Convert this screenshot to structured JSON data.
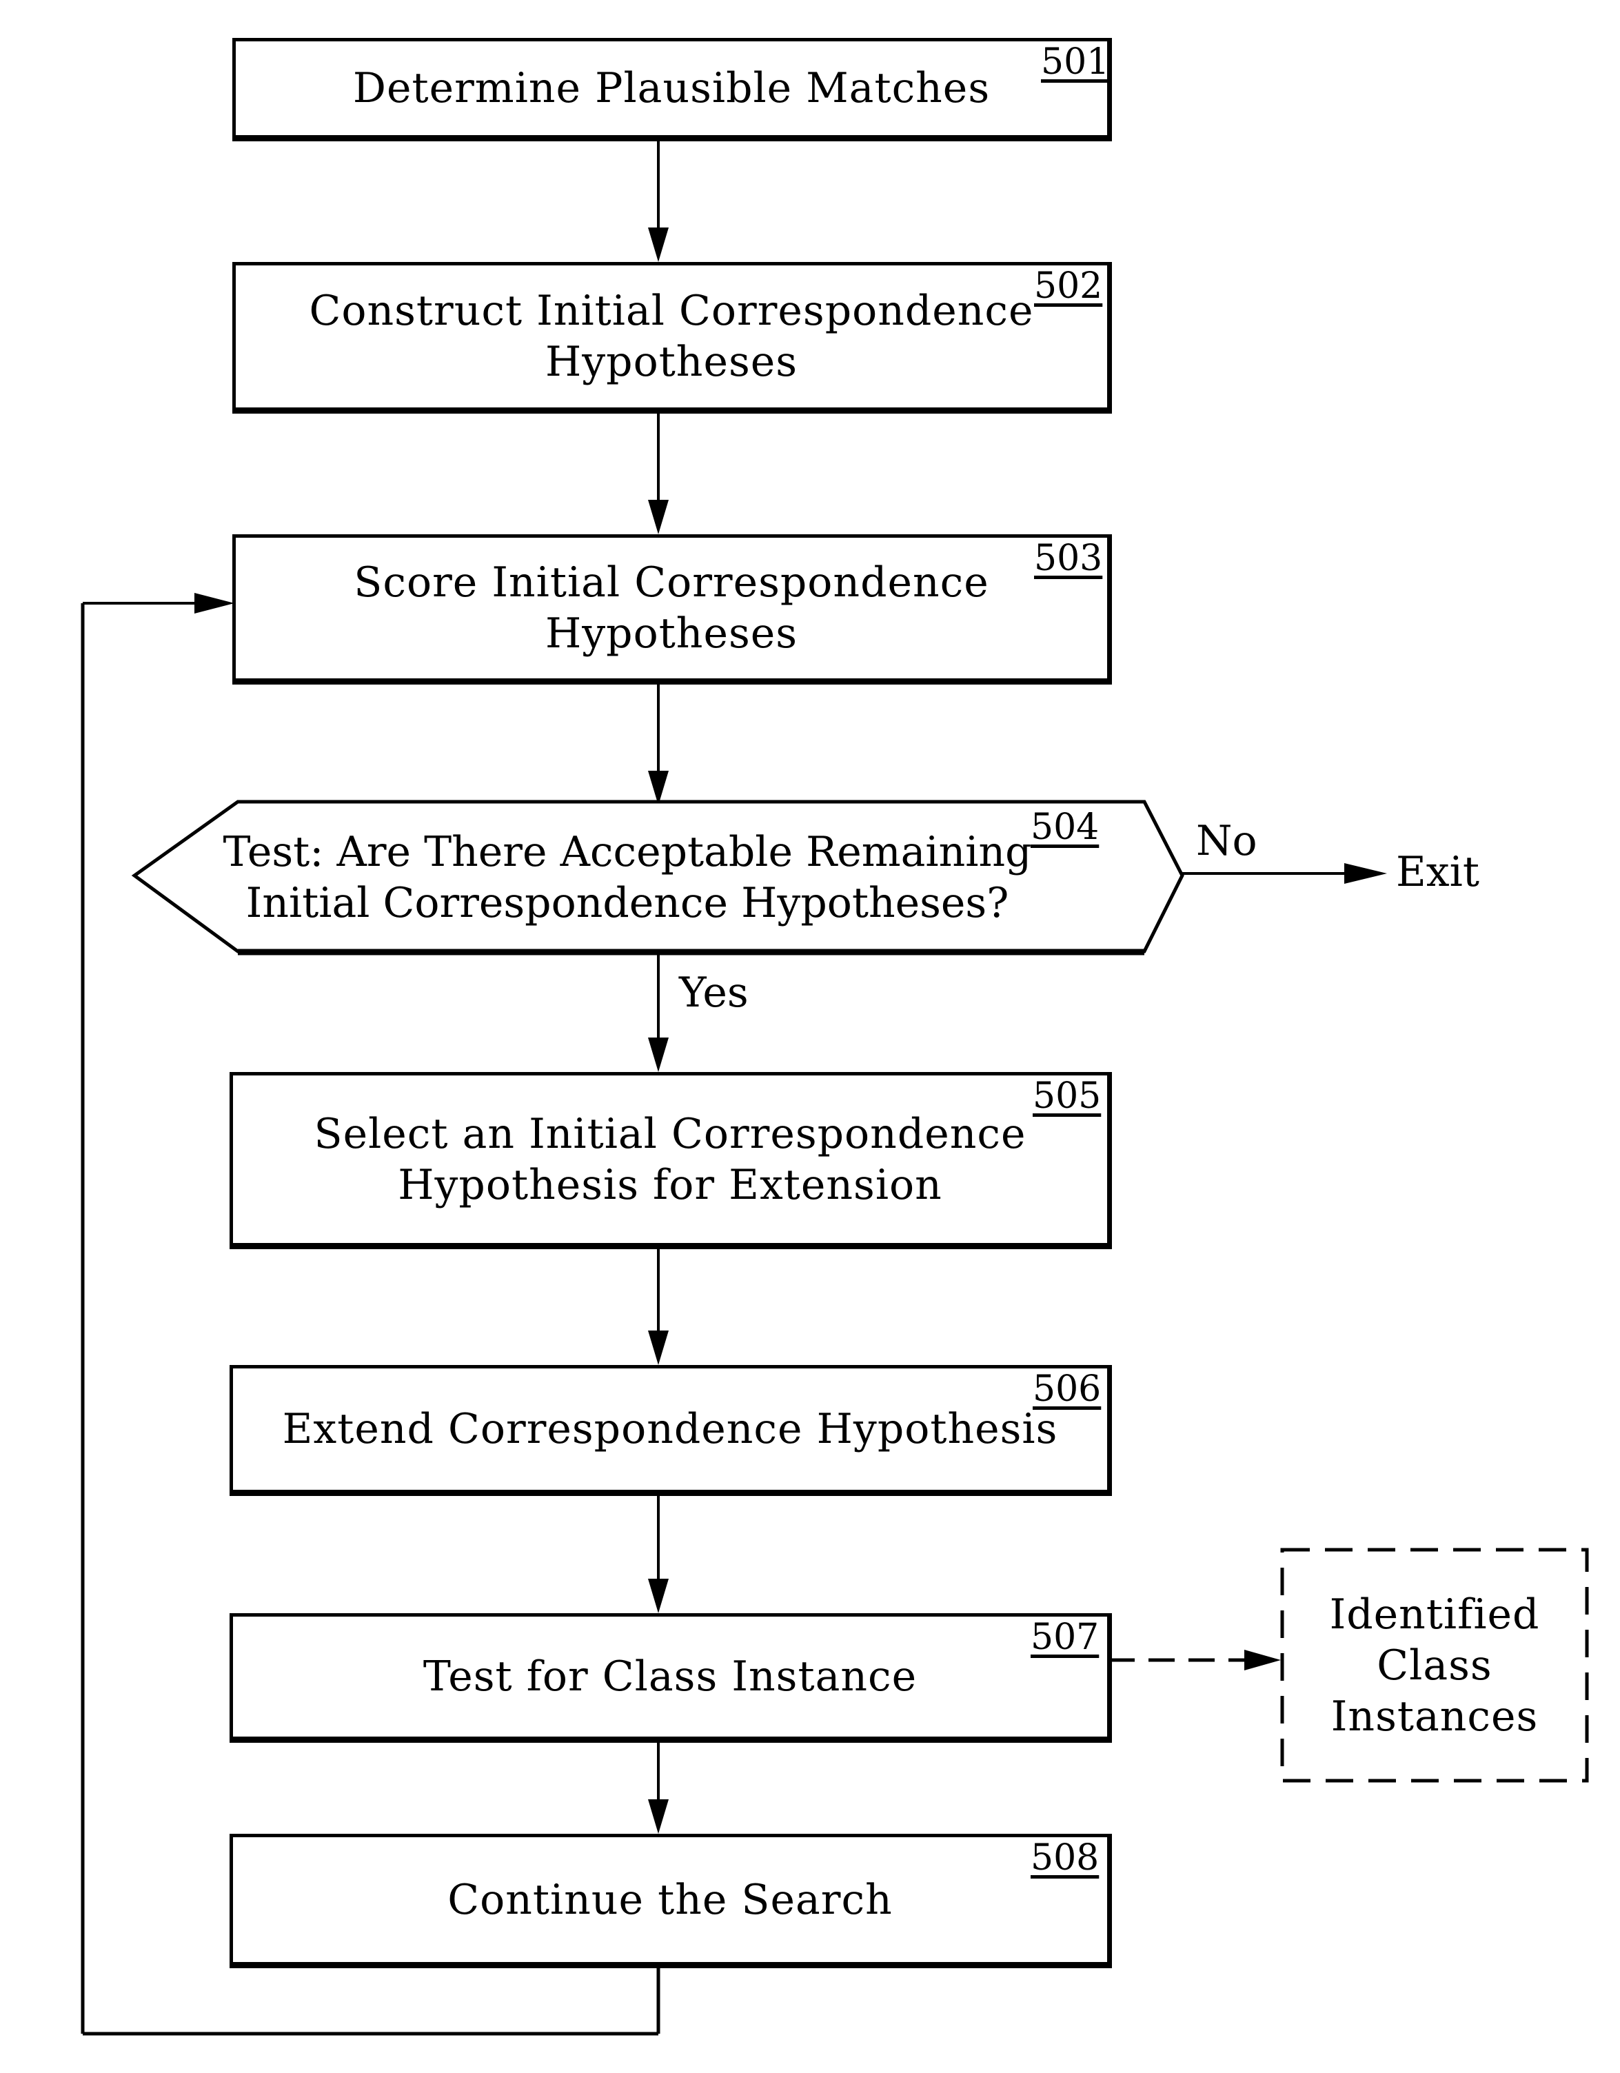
{
  "figure": {
    "steps": [
      {
        "id": "501",
        "label": "Determine  Plausible  Matches"
      },
      {
        "id": "502",
        "label": "Construct  Initial  Correspondence\nHypotheses"
      },
      {
        "id": "503",
        "label": "Score  Initial  Correspondence\nHypotheses"
      },
      {
        "id": "505",
        "label": "Select  an  Initial  Correspondence\nHypothesis  for  Extension"
      },
      {
        "id": "506",
        "label": "Extend  Correspondence  Hypothesis"
      },
      {
        "id": "507",
        "label": "Test  for  Class  Instance"
      },
      {
        "id": "508",
        "label": "Continue  the  Search"
      }
    ],
    "decision": {
      "id": "504",
      "label": "Test:  Are  There  Acceptable  Remaining\nInitial  Correspondence  Hypotheses?",
      "yes_label": "Yes",
      "no_label": "No",
      "exit_label": "Exit"
    },
    "output": {
      "label": "Identified\nClass\nInstances",
      "connection": "dashed"
    },
    "loop": {
      "from": "508",
      "to": "503"
    }
  }
}
